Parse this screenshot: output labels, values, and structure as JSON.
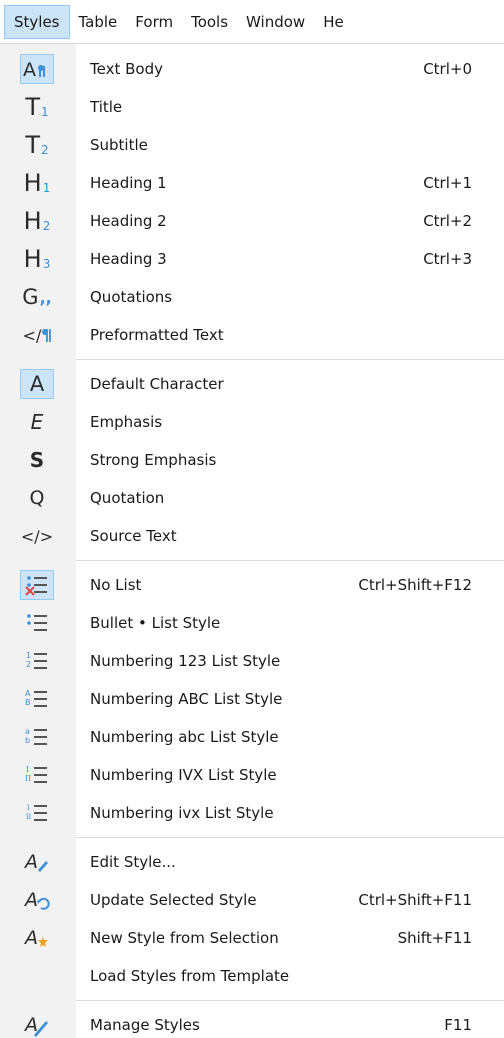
{
  "menubar": {
    "items": [
      "Styles",
      "Table",
      "Form",
      "Tools",
      "Window",
      "He"
    ]
  },
  "menu": {
    "paragraph": [
      {
        "label": "Text Body",
        "shortcut": "Ctrl+0",
        "icon": "text-body-icon"
      },
      {
        "label": "Title",
        "shortcut": "",
        "icon": "title-icon"
      },
      {
        "label": "Subtitle",
        "shortcut": "",
        "icon": "subtitle-icon"
      },
      {
        "label": "Heading 1",
        "shortcut": "Ctrl+1",
        "icon": "heading-1-icon"
      },
      {
        "label": "Heading 2",
        "shortcut": "Ctrl+2",
        "icon": "heading-2-icon"
      },
      {
        "label": "Heading 3",
        "shortcut": "Ctrl+3",
        "icon": "heading-3-icon"
      },
      {
        "label": "Quotations",
        "shortcut": "",
        "icon": "quotations-icon"
      },
      {
        "label": "Preformatted Text",
        "shortcut": "",
        "icon": "preformatted-text-icon"
      }
    ],
    "character": [
      {
        "label": "Default Character",
        "shortcut": "",
        "icon": "default-character-icon"
      },
      {
        "label": "Emphasis",
        "shortcut": "",
        "icon": "emphasis-icon"
      },
      {
        "label": "Strong Emphasis",
        "shortcut": "",
        "icon": "strong-emphasis-icon"
      },
      {
        "label": "Quotation",
        "shortcut": "",
        "icon": "quotation-icon"
      },
      {
        "label": "Source Text",
        "shortcut": "",
        "icon": "source-text-icon"
      }
    ],
    "lists": [
      {
        "label": "No List",
        "shortcut": "Ctrl+Shift+F12",
        "icon": "no-list-icon"
      },
      {
        "label": "Bullet • List Style",
        "shortcut": "",
        "icon": "bullet-list-icon"
      },
      {
        "label": "Numbering 123 List Style",
        "shortcut": "",
        "icon": "numbering-123-icon"
      },
      {
        "label": "Numbering ABC List Style",
        "shortcut": "",
        "icon": "numbering-abc-upper-icon"
      },
      {
        "label": "Numbering abc List Style",
        "shortcut": "",
        "icon": "numbering-abc-lower-icon"
      },
      {
        "label": "Numbering IVX List Style",
        "shortcut": "",
        "icon": "numbering-ivx-upper-icon"
      },
      {
        "label": "Numbering ivx List Style",
        "shortcut": "",
        "icon": "numbering-ivx-lower-icon"
      }
    ],
    "style_actions": [
      {
        "label": "Edit Style...",
        "shortcut": "",
        "icon": "edit-style-icon"
      },
      {
        "label": "Update Selected Style",
        "shortcut": "Ctrl+Shift+F11",
        "icon": "update-style-icon"
      },
      {
        "label": "New Style from Selection",
        "shortcut": "Shift+F11",
        "icon": "new-style-icon"
      },
      {
        "label": "Load Styles from Template",
        "shortcut": "",
        "icon": ""
      }
    ],
    "manage": [
      {
        "label": "Manage Styles",
        "shortcut": "F11",
        "icon": "manage-styles-icon"
      }
    ]
  },
  "icon_glyphs": {
    "title": [
      "T",
      "1"
    ],
    "subtitle": [
      "T",
      "2"
    ],
    "h1": [
      "H",
      "1"
    ],
    "h2": [
      "H",
      "2"
    ],
    "h3": [
      "H",
      "3"
    ],
    "default_character": "A",
    "emphasis": "E",
    "strong": "S",
    "quotation": "Q",
    "source_text": "</>",
    "preformatted": "</",
    "quotations": "G",
    "quotations_mark": ",,"
  },
  "colors": {
    "accent_blue": "#3d8fd6",
    "selection_fill": "#cce4f7",
    "selection_border": "#99c9ef",
    "no_list_x": "#e04646",
    "new_style_burst": "#f0a020"
  }
}
